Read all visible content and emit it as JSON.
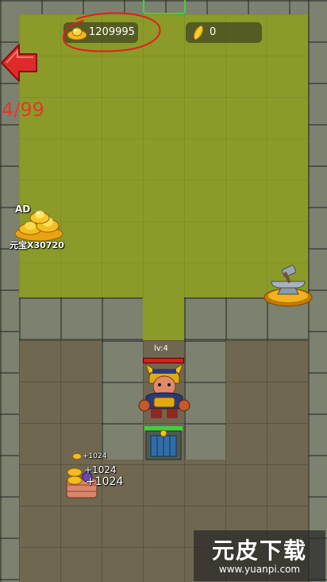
{
  "currency": {
    "gold_value": "1209995",
    "gold_icon": "gold-ingot-icon",
    "gem_value": "0",
    "gem_icon": "gold-leaf-icon"
  },
  "level_counter": "4/99",
  "ad_reward": {
    "label": "AD",
    "amount": "元宝X30720",
    "icon": "gold-ingot-pile-icon"
  },
  "hero": {
    "level_label": "lv:4",
    "hp_fraction": 1.0
  },
  "floating_rewards": [
    "+1024",
    "+1024",
    "+1024"
  ],
  "watermark": {
    "title": "元皮下载",
    "url": "www.yuanpi.com"
  },
  "colors": {
    "grass": "#8c9a2a",
    "floor": "#6f6750",
    "level_counter": "#e03a2a",
    "back_arrow": "#e02a2a",
    "circle_mark": "#e0201c"
  }
}
